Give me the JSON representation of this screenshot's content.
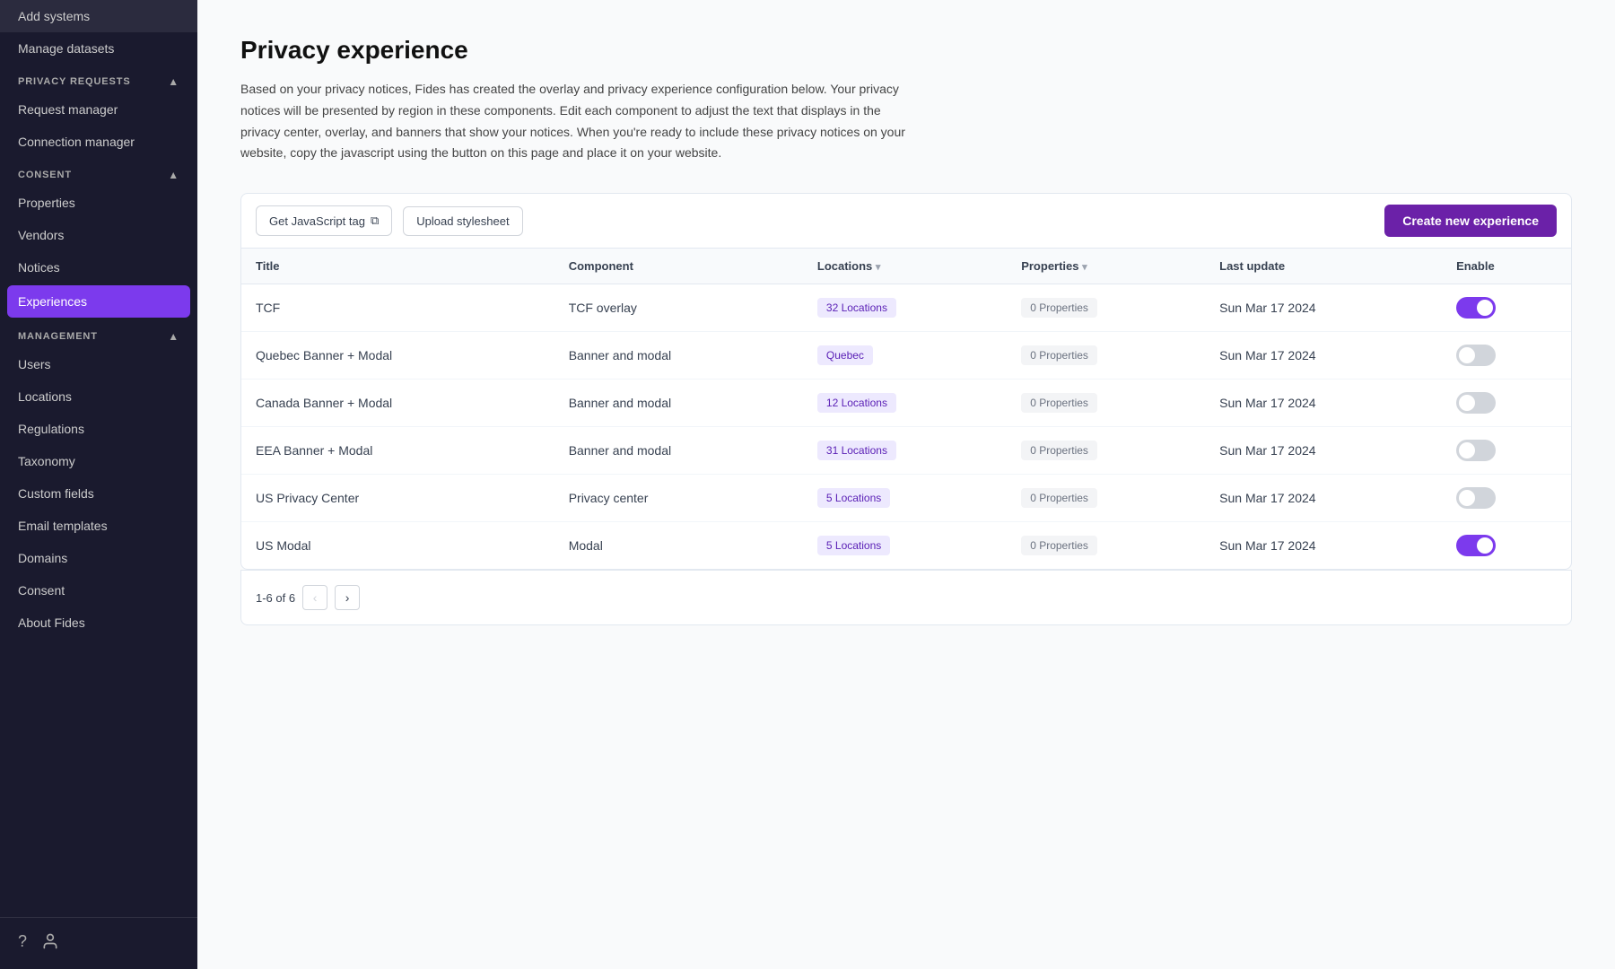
{
  "sidebar": {
    "top_items": [
      {
        "id": "add-systems",
        "label": "Add systems"
      },
      {
        "id": "manage-datasets",
        "label": "Manage datasets"
      }
    ],
    "sections": [
      {
        "id": "privacy-requests",
        "label": "PRIVACY REQUESTS",
        "collapsed": false,
        "items": [
          {
            "id": "request-manager",
            "label": "Request manager"
          },
          {
            "id": "connection-manager",
            "label": "Connection manager"
          }
        ]
      },
      {
        "id": "consent",
        "label": "CONSENT",
        "collapsed": false,
        "items": [
          {
            "id": "properties",
            "label": "Properties"
          },
          {
            "id": "vendors",
            "label": "Vendors"
          },
          {
            "id": "notices",
            "label": "Notices"
          },
          {
            "id": "experiences",
            "label": "Experiences",
            "active": true
          }
        ]
      },
      {
        "id": "management",
        "label": "MANAGEMENT",
        "collapsed": false,
        "items": [
          {
            "id": "users",
            "label": "Users"
          },
          {
            "id": "locations",
            "label": "Locations"
          },
          {
            "id": "regulations",
            "label": "Regulations"
          },
          {
            "id": "taxonomy",
            "label": "Taxonomy"
          },
          {
            "id": "custom-fields",
            "label": "Custom fields"
          },
          {
            "id": "email-templates",
            "label": "Email templates"
          },
          {
            "id": "domains",
            "label": "Domains"
          },
          {
            "id": "consent",
            "label": "Consent"
          },
          {
            "id": "about-fides",
            "label": "About Fides"
          }
        ]
      }
    ],
    "bottom_icons": [
      {
        "id": "help-icon",
        "label": "?"
      },
      {
        "id": "user-icon",
        "label": "👤"
      }
    ]
  },
  "page": {
    "title": "Privacy experience",
    "description": "Based on your privacy notices, Fides has created the overlay and privacy experience configuration below. Your privacy notices will be presented by region in these components. Edit each component to adjust the text that displays in the privacy center, overlay, and banners that show your notices. When you're ready to include these privacy notices on your website, copy the javascript using the button on this page and place it on your website."
  },
  "toolbar": {
    "get_js_tag_label": "Get JavaScript tag",
    "upload_stylesheet_label": "Upload stylesheet",
    "create_btn_label": "Create new experience"
  },
  "table": {
    "columns": [
      {
        "id": "title",
        "label": "Title"
      },
      {
        "id": "component",
        "label": "Component"
      },
      {
        "id": "locations",
        "label": "Locations",
        "sortable": true
      },
      {
        "id": "properties",
        "label": "Properties",
        "sortable": true
      },
      {
        "id": "last_update",
        "label": "Last update"
      },
      {
        "id": "enable",
        "label": "Enable"
      }
    ],
    "rows": [
      {
        "title": "TCF",
        "component": "TCF overlay",
        "locations": "32 Locations",
        "properties": "0 Properties",
        "last_update": "Sun Mar 17 2024",
        "enabled": true
      },
      {
        "title": "Quebec Banner + Modal",
        "component": "Banner and modal",
        "locations": "Quebec",
        "properties": "0 Properties",
        "last_update": "Sun Mar 17 2024",
        "enabled": false
      },
      {
        "title": "Canada Banner + Modal",
        "component": "Banner and modal",
        "locations": "12 Locations",
        "properties": "0 Properties",
        "last_update": "Sun Mar 17 2024",
        "enabled": false
      },
      {
        "title": "EEA Banner + Modal",
        "component": "Banner and modal",
        "locations": "31 Locations",
        "properties": "0 Properties",
        "last_update": "Sun Mar 17 2024",
        "enabled": false
      },
      {
        "title": "US Privacy Center",
        "component": "Privacy center",
        "locations": "5 Locations",
        "properties": "0 Properties",
        "last_update": "Sun Mar 17 2024",
        "enabled": false
      },
      {
        "title": "US Modal",
        "component": "Modal",
        "locations": "5 Locations",
        "properties": "0 Properties",
        "last_update": "Sun Mar 17 2024",
        "enabled": true
      }
    ]
  },
  "pagination": {
    "label": "1-6 of 6"
  }
}
